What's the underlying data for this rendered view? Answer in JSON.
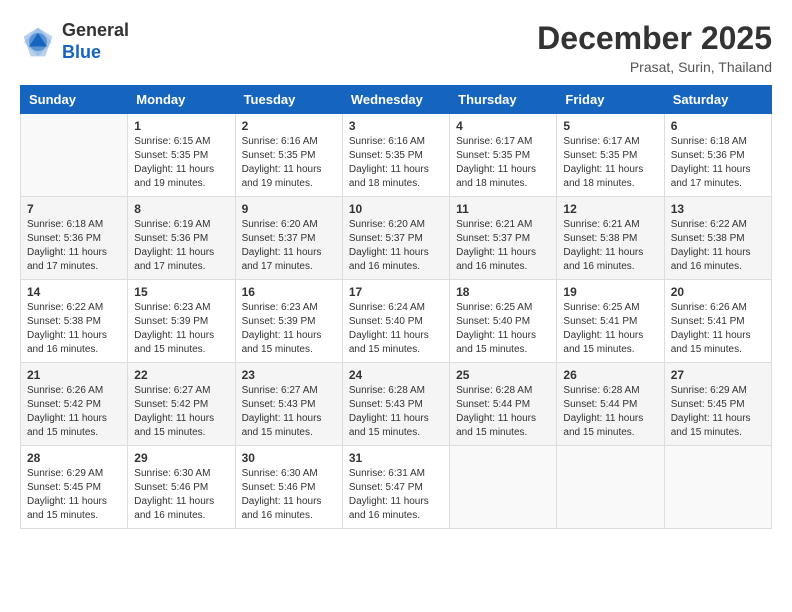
{
  "header": {
    "logo_general": "General",
    "logo_blue": "Blue",
    "month_title": "December 2025",
    "location": "Prasat, Surin, Thailand"
  },
  "calendar": {
    "days_of_week": [
      "Sunday",
      "Monday",
      "Tuesday",
      "Wednesday",
      "Thursday",
      "Friday",
      "Saturday"
    ],
    "weeks": [
      [
        {
          "day": "",
          "empty": true
        },
        {
          "day": "1",
          "sunrise": "6:15 AM",
          "sunset": "5:35 PM",
          "daylight": "11 hours and 19 minutes."
        },
        {
          "day": "2",
          "sunrise": "6:16 AM",
          "sunset": "5:35 PM",
          "daylight": "11 hours and 19 minutes."
        },
        {
          "day": "3",
          "sunrise": "6:16 AM",
          "sunset": "5:35 PM",
          "daylight": "11 hours and 18 minutes."
        },
        {
          "day": "4",
          "sunrise": "6:17 AM",
          "sunset": "5:35 PM",
          "daylight": "11 hours and 18 minutes."
        },
        {
          "day": "5",
          "sunrise": "6:17 AM",
          "sunset": "5:35 PM",
          "daylight": "11 hours and 18 minutes."
        },
        {
          "day": "6",
          "sunrise": "6:18 AM",
          "sunset": "5:36 PM",
          "daylight": "11 hours and 17 minutes."
        }
      ],
      [
        {
          "day": "7",
          "sunrise": "6:18 AM",
          "sunset": "5:36 PM",
          "daylight": "11 hours and 17 minutes."
        },
        {
          "day": "8",
          "sunrise": "6:19 AM",
          "sunset": "5:36 PM",
          "daylight": "11 hours and 17 minutes."
        },
        {
          "day": "9",
          "sunrise": "6:20 AM",
          "sunset": "5:37 PM",
          "daylight": "11 hours and 17 minutes."
        },
        {
          "day": "10",
          "sunrise": "6:20 AM",
          "sunset": "5:37 PM",
          "daylight": "11 hours and 16 minutes."
        },
        {
          "day": "11",
          "sunrise": "6:21 AM",
          "sunset": "5:37 PM",
          "daylight": "11 hours and 16 minutes."
        },
        {
          "day": "12",
          "sunrise": "6:21 AM",
          "sunset": "5:38 PM",
          "daylight": "11 hours and 16 minutes."
        },
        {
          "day": "13",
          "sunrise": "6:22 AM",
          "sunset": "5:38 PM",
          "daylight": "11 hours and 16 minutes."
        }
      ],
      [
        {
          "day": "14",
          "sunrise": "6:22 AM",
          "sunset": "5:38 PM",
          "daylight": "11 hours and 16 minutes."
        },
        {
          "day": "15",
          "sunrise": "6:23 AM",
          "sunset": "5:39 PM",
          "daylight": "11 hours and 15 minutes."
        },
        {
          "day": "16",
          "sunrise": "6:23 AM",
          "sunset": "5:39 PM",
          "daylight": "11 hours and 15 minutes."
        },
        {
          "day": "17",
          "sunrise": "6:24 AM",
          "sunset": "5:40 PM",
          "daylight": "11 hours and 15 minutes."
        },
        {
          "day": "18",
          "sunrise": "6:25 AM",
          "sunset": "5:40 PM",
          "daylight": "11 hours and 15 minutes."
        },
        {
          "day": "19",
          "sunrise": "6:25 AM",
          "sunset": "5:41 PM",
          "daylight": "11 hours and 15 minutes."
        },
        {
          "day": "20",
          "sunrise": "6:26 AM",
          "sunset": "5:41 PM",
          "daylight": "11 hours and 15 minutes."
        }
      ],
      [
        {
          "day": "21",
          "sunrise": "6:26 AM",
          "sunset": "5:42 PM",
          "daylight": "11 hours and 15 minutes."
        },
        {
          "day": "22",
          "sunrise": "6:27 AM",
          "sunset": "5:42 PM",
          "daylight": "11 hours and 15 minutes."
        },
        {
          "day": "23",
          "sunrise": "6:27 AM",
          "sunset": "5:43 PM",
          "daylight": "11 hours and 15 minutes."
        },
        {
          "day": "24",
          "sunrise": "6:28 AM",
          "sunset": "5:43 PM",
          "daylight": "11 hours and 15 minutes."
        },
        {
          "day": "25",
          "sunrise": "6:28 AM",
          "sunset": "5:44 PM",
          "daylight": "11 hours and 15 minutes."
        },
        {
          "day": "26",
          "sunrise": "6:28 AM",
          "sunset": "5:44 PM",
          "daylight": "11 hours and 15 minutes."
        },
        {
          "day": "27",
          "sunrise": "6:29 AM",
          "sunset": "5:45 PM",
          "daylight": "11 hours and 15 minutes."
        }
      ],
      [
        {
          "day": "28",
          "sunrise": "6:29 AM",
          "sunset": "5:45 PM",
          "daylight": "11 hours and 15 minutes."
        },
        {
          "day": "29",
          "sunrise": "6:30 AM",
          "sunset": "5:46 PM",
          "daylight": "11 hours and 16 minutes."
        },
        {
          "day": "30",
          "sunrise": "6:30 AM",
          "sunset": "5:46 PM",
          "daylight": "11 hours and 16 minutes."
        },
        {
          "day": "31",
          "sunrise": "6:31 AM",
          "sunset": "5:47 PM",
          "daylight": "11 hours and 16 minutes."
        },
        {
          "day": "",
          "empty": true
        },
        {
          "day": "",
          "empty": true
        },
        {
          "day": "",
          "empty": true
        }
      ]
    ]
  }
}
